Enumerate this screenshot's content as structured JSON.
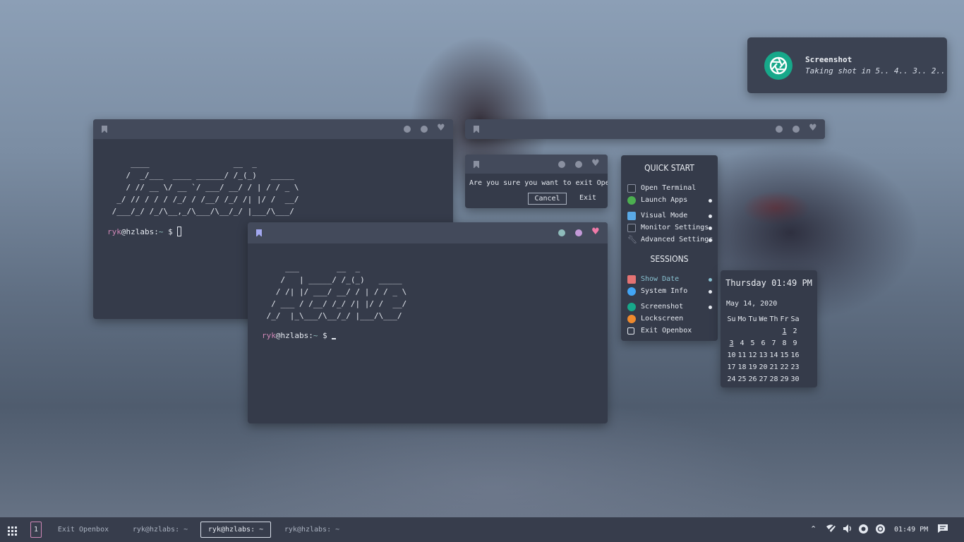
{
  "notification": {
    "icon": "camera-shutter-icon",
    "title": "Screenshot",
    "body": "Taking shot in 5.. 4.. 3.. 2.."
  },
  "terminal_back": {
    "ascii": "     ____                  __  _\n    /  _/___  ____ ______/ /_(_)   _____\n    / // __ \\/ __ `/ ___/ __/ / | / / _ \\\n  _/ // / / / /_/ / /__/ /_/ /| |/ /  __/\n /___/_/ /_/\\__,_/\\___/\\__/_/ |___/\\___/",
    "prompt_user": "ryk",
    "prompt_host": "@hzlabs:",
    "prompt_path": "~",
    "prompt_symbol": " $ "
  },
  "terminal_front": {
    "ascii": "     ___        __  _\n    /   | _____/ /_(_)   _____\n   / /| |/ ___/ __/ / | / / _ \\\n  / ___ / /__/ /_/ /| |/ /  __/\n /_/  |_\\___/\\__/_/ |___/\\___/",
    "prompt_user": "ryk",
    "prompt_host": "@hzlabs:",
    "prompt_path": "~",
    "prompt_symbol": " $ "
  },
  "exit_dialog": {
    "message": "Are you sure you want to exit Openbox?",
    "cancel_label": "Cancel",
    "exit_label": "Exit"
  },
  "menu": {
    "quick_start_title": "QUICK START",
    "sessions_title": "SESSIONS",
    "quick_items": [
      {
        "label": "Open Terminal",
        "icon": "terminal-icon",
        "color": "#2e3440"
      },
      {
        "label": "Launch Apps",
        "icon": "check-circle-icon",
        "color": "#4caf50"
      },
      {
        "label": "Visual Mode",
        "icon": "display-icon",
        "color": "#5aa9e6"
      },
      {
        "label": "Monitor Settings",
        "icon": "monitor-icon",
        "color": "#2e3440"
      },
      {
        "label": "Advanced Settings",
        "icon": "wrench-icon",
        "color": "#8a90a0"
      }
    ],
    "session_items": [
      {
        "label": "Show Date",
        "icon": "calendar-icon",
        "color": "#e57373"
      },
      {
        "label": "System Info",
        "icon": "info-icon",
        "color": "#42a5f5"
      },
      {
        "label": "Screenshot",
        "icon": "camera-shutter-icon",
        "color": "#17a88a"
      },
      {
        "label": "Lockscreen",
        "icon": "lock-icon",
        "color": "#ef8a2e"
      },
      {
        "label": "Exit Openbox",
        "icon": "exit-icon",
        "color": "#e5e9f0"
      }
    ]
  },
  "calendar": {
    "header": "Thursday 01:49 PM",
    "date": "May 14, 2020",
    "weekdays": [
      "Su",
      "Mo",
      "Tu",
      "We",
      "Th",
      "Fr",
      "Sa"
    ],
    "weeks": [
      [
        "",
        "",
        "",
        "",
        "",
        "1",
        "2"
      ],
      [
        "3",
        "4",
        "5",
        "6",
        "7",
        "8",
        "9"
      ],
      [
        "10",
        "11",
        "12",
        "13",
        "14",
        "15",
        "16"
      ],
      [
        "17",
        "18",
        "19",
        "20",
        "21",
        "22",
        "23"
      ],
      [
        "24",
        "25",
        "26",
        "27",
        "28",
        "29",
        "30"
      ]
    ]
  },
  "taskbar": {
    "apps_icon": "app-grid-icon",
    "workspace": "1",
    "tasks": [
      {
        "label": "Exit Openbox",
        "active": false
      },
      {
        "label": "ryk@hzlabs: ~",
        "active": false
      },
      {
        "label": "ryk@hzlabs: ~",
        "active": true
      },
      {
        "label": "ryk@hzlabs: ~",
        "active": false
      }
    ],
    "tray": [
      "chevron-up-icon",
      "wifi-off-icon",
      "volume-icon",
      "record-icon",
      "camera-shutter-icon"
    ],
    "clock": "01:49 PM",
    "notifications_icon": "chat-icon"
  }
}
